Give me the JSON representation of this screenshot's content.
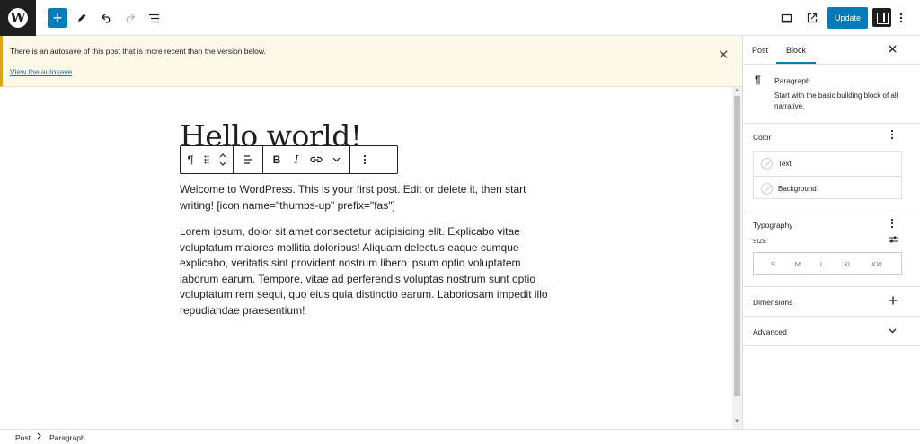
{
  "topbar": {
    "logo_letter": "W",
    "add_symbol": "+",
    "update_label": "Update"
  },
  "notice": {
    "message": "There is an autosave of this post that is more recent than the version below.",
    "link": "View the autosave",
    "close_symbol": "✕"
  },
  "editor": {
    "title": "Hello world!",
    "paragraph1_line1": "Welcome to WordPress. This is your first post. Edit or delete it, then start",
    "paragraph1_line2": "writing! [icon name=\"thumbs-up\" prefix=\"fas\"]",
    "paragraph2": "Lorem ipsum, dolor sit amet consectetur adipisicing elit. Explicabo vitae voluptatum maiores mollitia doloribus! Aliquam delectus eaque cumque explicabo, veritatis sint provident nostrum libero ipsum optio voluptatem laborum earum. Tempore, vitae ad perferendis voluptas nostrum sunt optio voluptatum rem sequi, quo eius quia distinctio earum. Laboriosam impedit illo repudiandae praesentium!"
  },
  "sidebar": {
    "tabs": [
      {
        "label": "Post",
        "active": false
      },
      {
        "label": "Block",
        "active": true
      }
    ],
    "block": {
      "title": "Paragraph",
      "description": "Start with the basic building block of all narrative."
    },
    "color": {
      "title": "Color",
      "items": [
        "Text",
        "Background"
      ]
    },
    "typography": {
      "title": "Typography",
      "size_label": "SIZE",
      "sizes": [
        "S",
        "M",
        "L",
        "XL",
        "XXL"
      ]
    },
    "dimensions": {
      "title": "Dimensions"
    },
    "advanced": {
      "title": "Advanced"
    }
  },
  "breadcrumb": [
    "Post",
    "Paragraph"
  ],
  "colors": {
    "accent": "#007cba",
    "notice_bg": "#fcf9e8",
    "notice_border": "#dba617",
    "dark": "#1e1e1e"
  },
  "icons": [
    "wordpress-logo-icon",
    "add-block-icon",
    "pencil-icon",
    "undo-icon",
    "redo-icon",
    "list-view-icon",
    "preview-icon",
    "external-link-icon",
    "settings-icon",
    "options-icon"
  ]
}
